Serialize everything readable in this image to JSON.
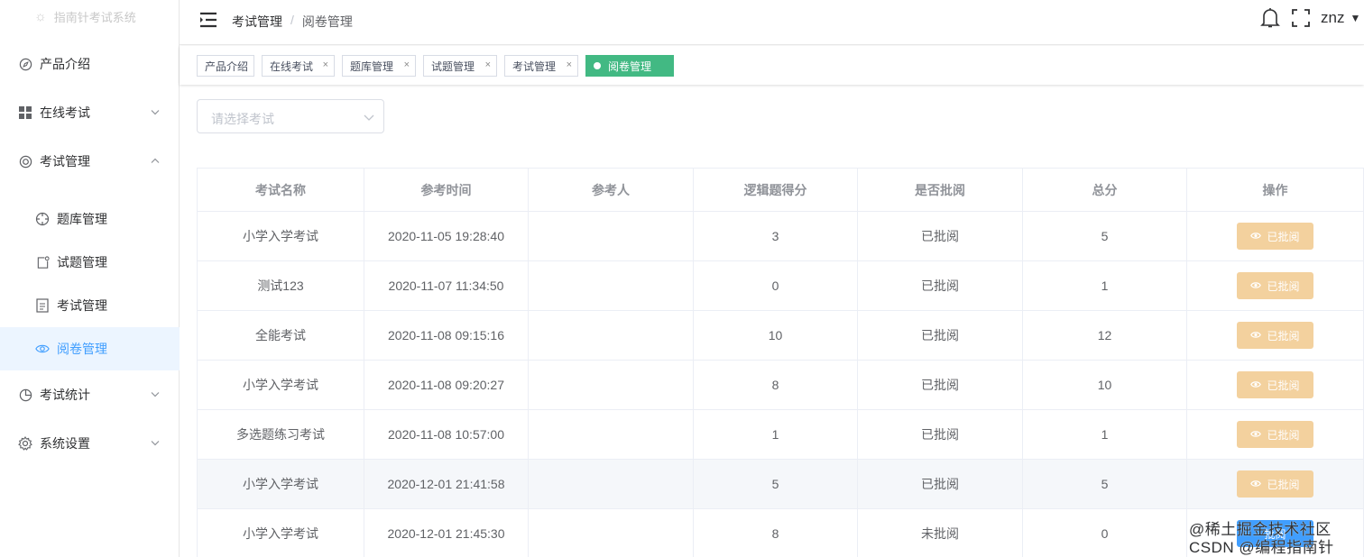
{
  "sidebar": {
    "logo_text": "指南针考试系统",
    "items": [
      {
        "label": "产品介绍",
        "icon": "compass-icon"
      },
      {
        "label": "在线考试",
        "icon": "grid-icon"
      },
      {
        "label": "考试管理",
        "icon": "lifebuoy-icon"
      },
      {
        "label": "题库管理",
        "icon": "crosshair-icon"
      },
      {
        "label": "试题管理",
        "icon": "note-icon"
      },
      {
        "label": "考试管理",
        "icon": "document-icon"
      },
      {
        "label": "阅卷管理",
        "icon": "eye-icon"
      },
      {
        "label": "考试统计",
        "icon": "pie-chart-icon"
      },
      {
        "label": "系统设置",
        "icon": "gear-icon"
      }
    ]
  },
  "header": {
    "breadcrumb": [
      "考试管理",
      "阅卷管理"
    ],
    "breadcrumb_sep": "/",
    "user": "znz"
  },
  "tags": [
    {
      "label": "产品介绍"
    },
    {
      "label": "在线考试"
    },
    {
      "label": "题库管理"
    },
    {
      "label": "试题管理"
    },
    {
      "label": "考试管理"
    },
    {
      "label": "阅卷管理"
    }
  ],
  "tag_close": "×",
  "filter": {
    "placeholder": "请选择考试"
  },
  "table": {
    "columns": [
      "考试名称",
      "参考时间",
      "参考人",
      "逻辑题得分",
      "是否批阅",
      "总分",
      "操作"
    ],
    "rows": [
      {
        "name": "小学入学考试",
        "time": "2020-11-05 19:28:40",
        "person": "",
        "logic": "3",
        "reviewed": "已批阅",
        "total": "5",
        "action": "已批阅"
      },
      {
        "name": "测试123",
        "time": "2020-11-07 11:34:50",
        "person": "",
        "logic": "0",
        "reviewed": "已批阅",
        "total": "1",
        "action": "已批阅"
      },
      {
        "name": "全能考试",
        "time": "2020-11-08 09:15:16",
        "person": "",
        "logic": "10",
        "reviewed": "已批阅",
        "total": "12",
        "action": "已批阅"
      },
      {
        "name": "小学入学考试",
        "time": "2020-11-08 09:20:27",
        "person": "",
        "logic": "8",
        "reviewed": "已批阅",
        "total": "10",
        "action": "已批阅"
      },
      {
        "name": "多选题练习考试",
        "time": "2020-11-08 10:57:00",
        "person": "",
        "logic": "1",
        "reviewed": "已批阅",
        "total": "1",
        "action": "已批阅"
      },
      {
        "name": "小学入学考试",
        "time": "2020-12-01 21:41:58",
        "person": "",
        "logic": "5",
        "reviewed": "已批阅",
        "total": "5",
        "action": "已批阅"
      },
      {
        "name": "小学入学考试",
        "time": "2020-12-01 21:45:30",
        "person": "",
        "logic": "8",
        "reviewed": "未批阅",
        "total": "0",
        "action": "批阅"
      }
    ]
  },
  "watermark": {
    "line1": "@稀土掘金技术社区",
    "line2": "CSDN @编程指南针"
  },
  "colors": {
    "accent": "#409eff",
    "tag_active": "#42b983",
    "reviewed_button": "#f3d19e"
  }
}
